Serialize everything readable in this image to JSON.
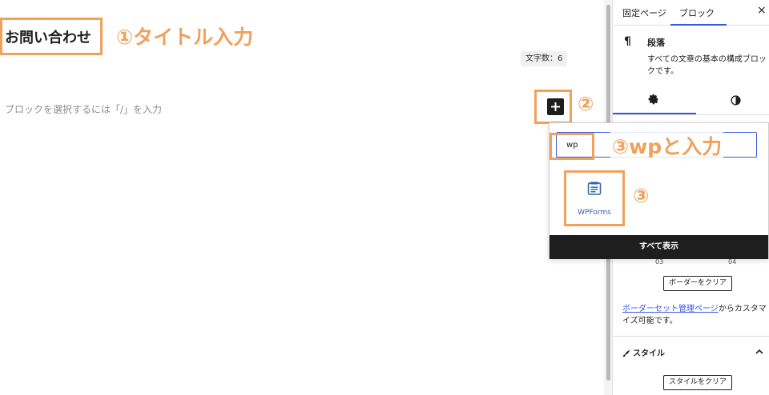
{
  "editor": {
    "title": "お問い合わせ",
    "annotation_title": "①タイトル入力",
    "word_count": "文字数：6",
    "placeholder": "ブロックを選択するには「/」を入力",
    "annotation_plus": "②"
  },
  "sidebar": {
    "tabs": [
      {
        "label": "固定ページ"
      },
      {
        "label": "ブロック"
      }
    ],
    "close_label": "×",
    "block": {
      "icon": "pilcrow-icon",
      "name": "段落",
      "description": "すべての文章の基本の構成ブロックです。"
    },
    "settings_tabs": [
      {
        "icon": "gear-icon"
      },
      {
        "icon": "contrast-icon"
      }
    ],
    "border_ticks": [
      "03",
      "04"
    ],
    "border_clear_label": "ボーダーをクリア",
    "border_note_link": "ボーダーセット管理ページ",
    "border_note_text": "からカスタマイズ可能です。",
    "style_header": "スタイル",
    "style_clear_label": "スタイルをクリア"
  },
  "inserter": {
    "search_value": "wp",
    "annotation_search": "③wpと入力",
    "result": {
      "label": "WPForms",
      "icon": "wpforms-icon"
    },
    "annotation_result": "③",
    "show_all_label": "すべて表示"
  },
  "colors": {
    "annotation": "#f0a15c",
    "accent": "#3858e9",
    "dark": "#1e1e1e",
    "wpforms": "#2c64ae"
  }
}
